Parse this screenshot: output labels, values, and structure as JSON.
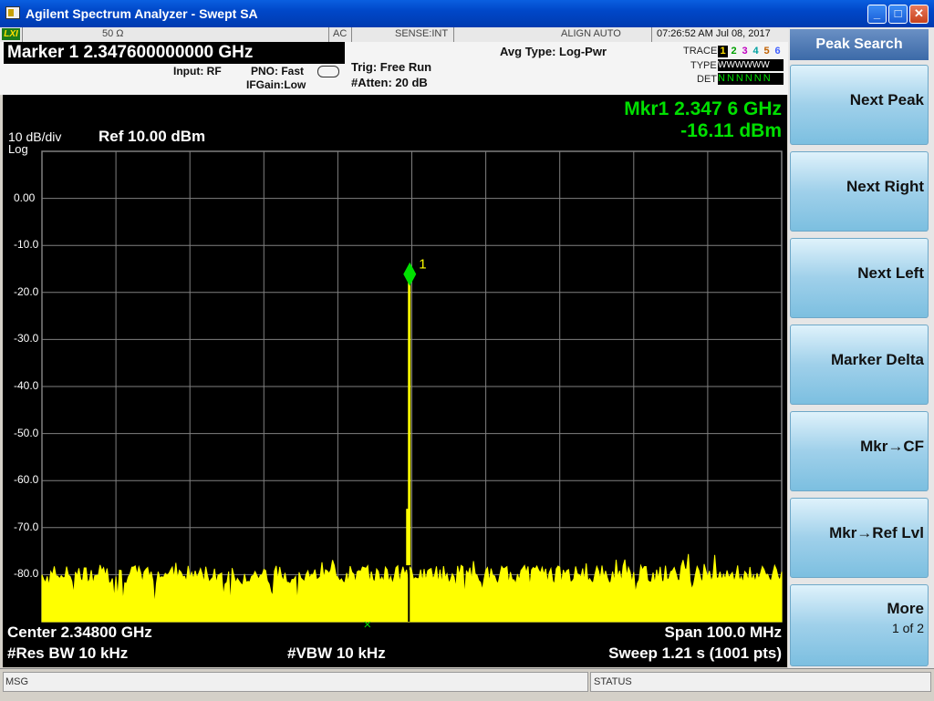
{
  "window": {
    "title": "Agilent Spectrum Analyzer - Swept SA",
    "minimize_glyph": "_",
    "maximize_glyph": "□",
    "close_glyph": "✕"
  },
  "status_strip": {
    "lxi": "LXI",
    "impedance": "50 Ω",
    "coupling": "AC",
    "sense": "SENSE:INT",
    "align": "ALIGN AUTO",
    "datetime": "07:26:52 AM Jul 08, 2017"
  },
  "info": {
    "marker_readout": "Marker 1  2.347600000000 GHz",
    "input": "Input: RF",
    "pno": "PNO: Fast",
    "ifgain": "IFGain:Low",
    "trig": "Trig: Free Run",
    "atten": "#Atten: 20 dB",
    "avg_type": "Avg Type: Log-Pwr",
    "trace_label": "TRACE",
    "type_label": "TYPE",
    "det_label": "DET",
    "trace_digits": [
      "1",
      "2",
      "3",
      "4",
      "5",
      "6"
    ],
    "trace_colors": [
      "#d0c000",
      "#00a000",
      "#c000c0",
      "#00a0a0",
      "#c06000",
      "#4060ff"
    ],
    "type_value": "WWWWWW",
    "det_value": "NNNNNN"
  },
  "graph": {
    "scale": "10 dB/div",
    "scale_type": "Log",
    "ref_level": "Ref 10.00 dBm",
    "mkr_freq": "Mkr1 2.347 6 GHz",
    "mkr_ampl": "-16.11 dBm",
    "marker_label": "1",
    "y_ticks": [
      "0.00",
      "-10.0",
      "-20.0",
      "-30.0",
      "-40.0",
      "-50.0",
      "-60.0",
      "-70.0",
      "-80.0"
    ],
    "center": "Center 2.34800 GHz",
    "res_bw": "#Res BW 10 kHz",
    "vbw": "#VBW 10 kHz",
    "span": "Span 100.0 MHz",
    "sweep": "Sweep  1.21 s (1001 pts)",
    "trace_color": "#ffff00",
    "marker_color": "#00e000",
    "grid_color": "#808080"
  },
  "chart_data": {
    "type": "line",
    "x_center_ghz": 2.348,
    "x_span_mhz": 100.0,
    "points": 1001,
    "ylim": [
      -90,
      10
    ],
    "noise_floor_dbm": -80,
    "peak": {
      "x_ghz": 2.3476,
      "y_dbm": -16.11
    }
  },
  "softkeys": {
    "title": "Peak Search",
    "items": [
      {
        "label": "Next Peak"
      },
      {
        "label": "Next Right"
      },
      {
        "label": "Next Left"
      },
      {
        "label": "Marker Delta"
      },
      {
        "label": "Mkr→CF"
      },
      {
        "label": "Mkr→Ref Lvl"
      },
      {
        "label": "More",
        "sub": "1 of 2"
      }
    ]
  },
  "bottom": {
    "msg": "MSG",
    "status": "STATUS"
  }
}
